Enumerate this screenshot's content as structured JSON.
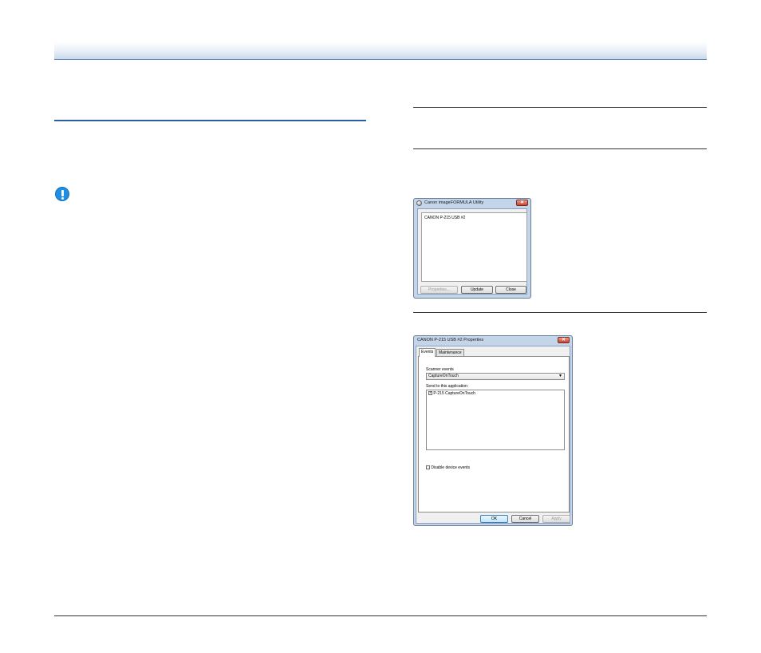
{
  "utility_dialog": {
    "title": "Canon imageFORMULA Utility",
    "close_glyph": "✕",
    "device_item": "CANON P-215 USB #2",
    "buttons": {
      "properties": "Properties...",
      "update": "Update",
      "close": "Close"
    }
  },
  "properties_dialog": {
    "title": "CANON P-215 USB #2 Properties",
    "close_glyph": "✕",
    "tabs": [
      "Events",
      "Maintenance"
    ],
    "scanner_events_label": "Scanner events",
    "scanner_events_value": "CaptureOnTouch",
    "send_to_label": "Send to this application:",
    "app_item": "P-215 CaptureOnTouch",
    "app_checked": true,
    "disable_label": "Disable device events",
    "buttons": {
      "ok": "OK",
      "cancel": "Cancel",
      "apply": "Apply"
    }
  },
  "icons": {
    "caution": "caution-icon"
  },
  "colors": {
    "accent_blue": "#2a5ea8",
    "caution_blue": "#1f8ee3",
    "close_red": "#c7412b"
  }
}
